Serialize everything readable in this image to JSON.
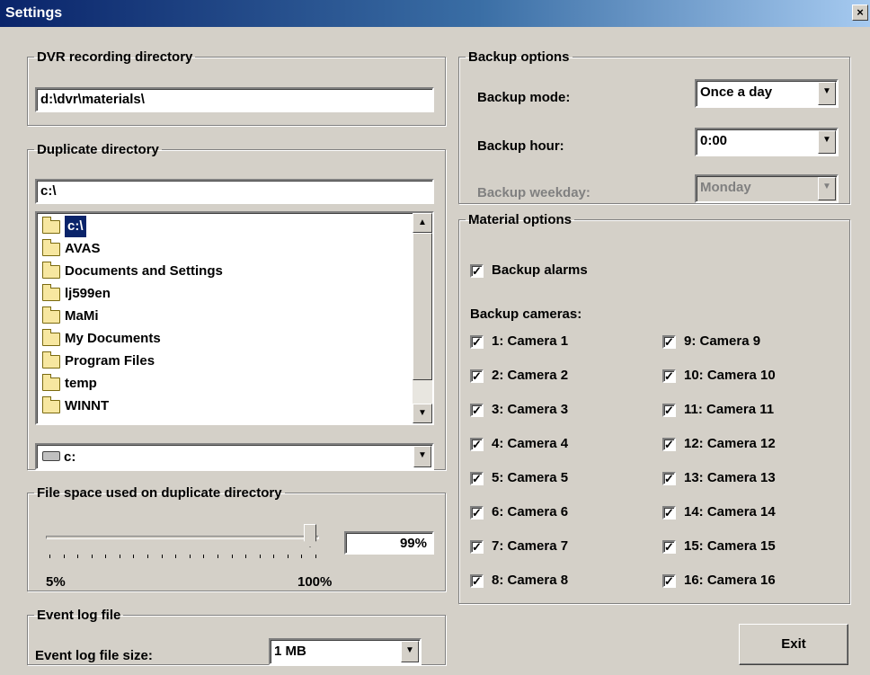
{
  "window": {
    "title": "Settings",
    "close_glyph": "×"
  },
  "dvr": {
    "legend": "DVR recording directory",
    "path": "d:\\dvr\\materials\\"
  },
  "duplicate": {
    "legend": "Duplicate directory",
    "path": "c:\\",
    "tree": [
      {
        "label": "c:\\",
        "icon": "open-folder-icon",
        "selected": true
      },
      {
        "label": "AVAS",
        "icon": "folder-icon"
      },
      {
        "label": "Documents and Settings",
        "icon": "folder-icon"
      },
      {
        "label": "lj599en",
        "icon": "folder-icon"
      },
      {
        "label": "MaMi",
        "icon": "folder-icon"
      },
      {
        "label": "My Documents",
        "icon": "folder-icon"
      },
      {
        "label": "Program Files",
        "icon": "folder-icon"
      },
      {
        "label": "temp",
        "icon": "folder-icon"
      },
      {
        "label": "WINNT",
        "icon": "folder-icon"
      }
    ],
    "drive": "c:"
  },
  "filespace": {
    "legend": "File space used on duplicate directory",
    "min_label": "5%",
    "max_label": "100%",
    "value": "99%",
    "level_fraction": 0.99
  },
  "eventlog": {
    "legend": "Event log file",
    "label": "Event log file size:",
    "value": "1 MB"
  },
  "backup": {
    "legend": "Backup options",
    "mode_label": "Backup mode:",
    "mode_value": "Once a day",
    "hour_label": "Backup hour:",
    "hour_value": "0:00",
    "weekday_label": "Backup weekday:",
    "weekday_value": "Monday"
  },
  "material": {
    "legend": "Material options",
    "alarms_label": "Backup alarms",
    "alarms_checked": true,
    "cameras_label": "Backup cameras:",
    "cameras": [
      "1: Camera 1",
      "2: Camera 2",
      "3: Camera 3",
      "4: Camera 4",
      "5: Camera 5",
      "6: Camera 6",
      "7: Camera 7",
      "8: Camera 8",
      "9: Camera 9",
      "10: Camera 10",
      "11: Camera 11",
      "12: Camera 12",
      "13: Camera 13",
      "14: Camera 14",
      "15: Camera 15",
      "16: Camera 16"
    ],
    "check_glyph": "✓"
  },
  "exit_label": "Exit",
  "arrows": {
    "down": "▼",
    "up": "▲"
  }
}
